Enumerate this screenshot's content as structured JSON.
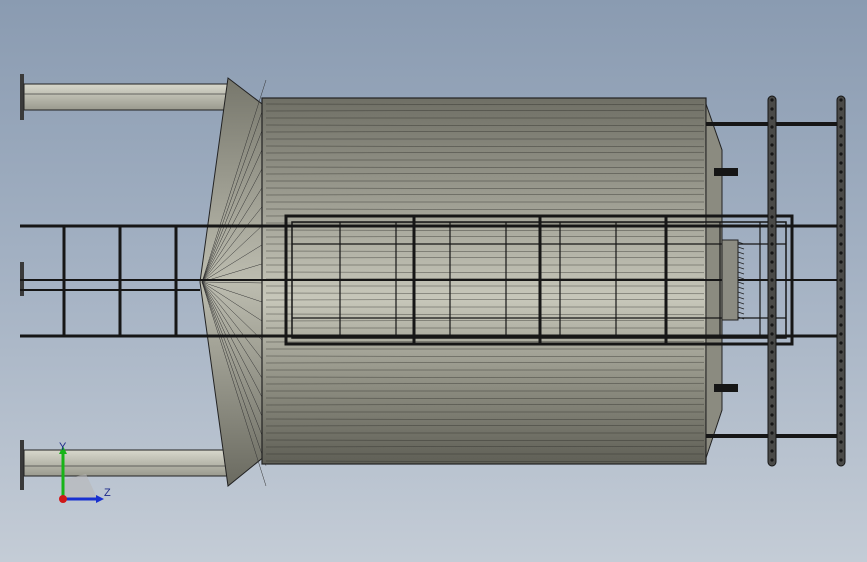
{
  "viewport": {
    "background_top": "#8a9bb1",
    "background_bottom": "#c4ccd6"
  },
  "model": {
    "view": "top",
    "body_color": "#8f8f84",
    "frame_color": "#1e1e1e"
  },
  "triad": {
    "y_label": "Y",
    "z_label": "Z",
    "x_color": "#d01818",
    "y_color": "#18b418",
    "z_color": "#1830d0"
  }
}
